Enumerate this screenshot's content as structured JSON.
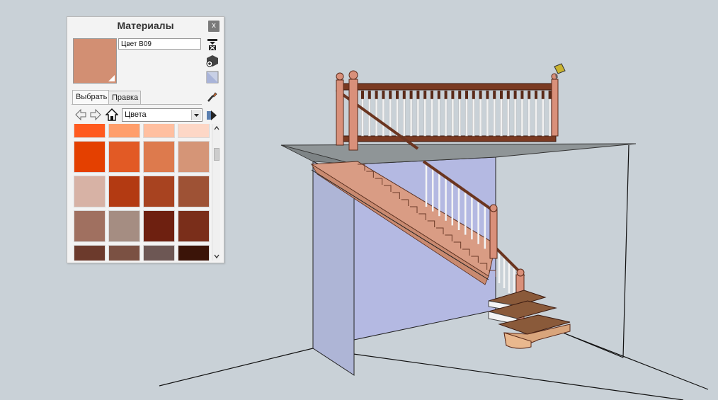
{
  "panel": {
    "title": "Материалы",
    "close_label": "x",
    "material_name": "Цвет B09",
    "current_color": "#d28f73",
    "tabs": [
      {
        "label": "Выбрать",
        "active": true
      },
      {
        "label": "Правка",
        "active": false
      }
    ],
    "collection": "Цвета",
    "icons": {
      "create": "create-material-icon",
      "default": "default-material-icon",
      "sample": "sample-paint-icon",
      "back": "back-arrow-icon",
      "forward": "forward-arrow-icon",
      "home": "home-icon",
      "details": "details-arrow-icon"
    },
    "swatches": [
      "#ff5a1f",
      "#ff9e6b",
      "#ffbfa0",
      "#fdd7c6",
      "#e44000",
      "#e25a25",
      "#dd7a4d",
      "#d59577",
      "#d7b2a5",
      "#b33a12",
      "#a84320",
      "#9e5235",
      "#a07060",
      "#a58d82",
      "#6e2010",
      "#7a2e1a",
      "#6c3a2c",
      "#7b5143",
      "#6d5754",
      "#3b1408"
    ]
  },
  "scene": {
    "tool": "paint-bucket-cursor-icon"
  }
}
